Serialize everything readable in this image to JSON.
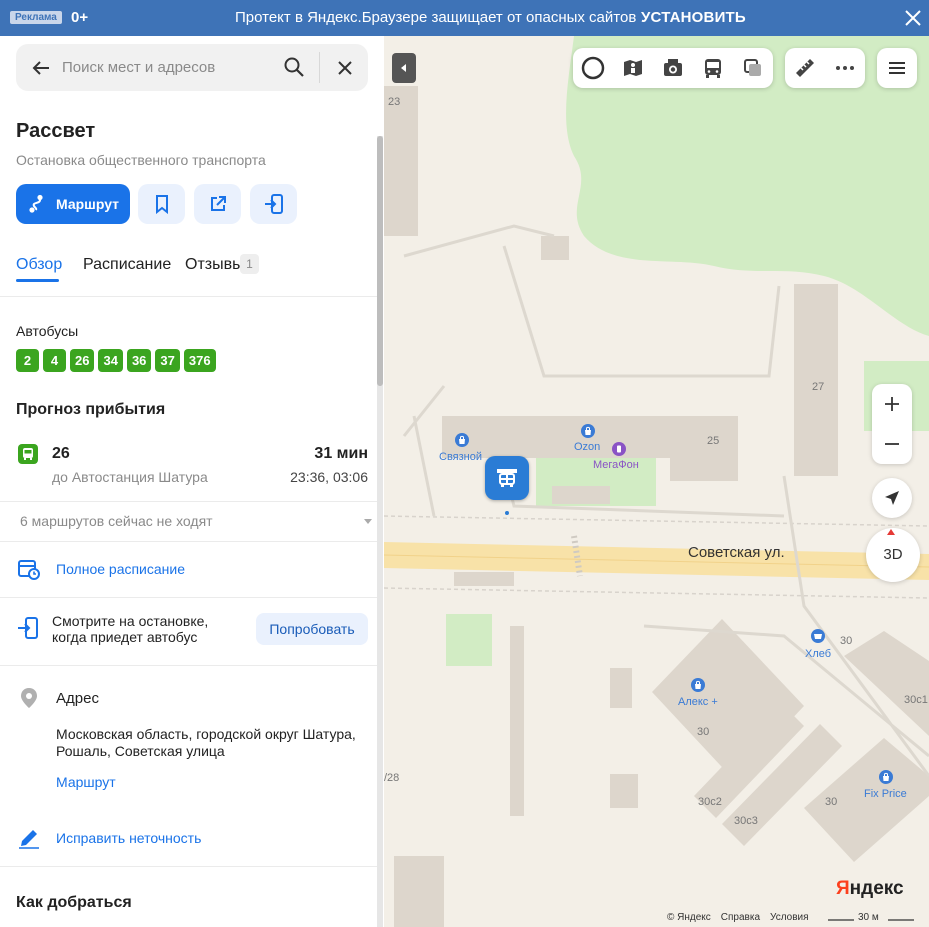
{
  "banner": {
    "ad_label": "Реклама",
    "age": "0+",
    "text": "Протект в Яндекс.Браузере защищает от опасных сайтов",
    "install": "УСТАНОВИТЬ"
  },
  "search": {
    "placeholder": "Поиск мест и адресов"
  },
  "place": {
    "title": "Рассвет",
    "subtitle": "Остановка общественного транспорта"
  },
  "actions": {
    "route_label": "Маршрут"
  },
  "tabs": [
    {
      "label": "Обзор",
      "active": true
    },
    {
      "label": "Расписание",
      "active": false
    },
    {
      "label": "Отзывы",
      "active": false,
      "count": "1"
    }
  ],
  "buses": {
    "label": "Автобусы",
    "routes": [
      "2",
      "4",
      "26",
      "34",
      "36",
      "37",
      "376"
    ]
  },
  "forecast": {
    "heading": "Прогноз прибытия",
    "route": "26",
    "destination": "до Автостанция Шатура",
    "eta": "31 мин",
    "times": "23:36, 03:06",
    "inactive": "6 маршрутов сейчас не ходят"
  },
  "full_schedule": "Полное расписание",
  "watch": {
    "text": "Смотрите на остановке, когда приедет автобус",
    "button": "Попробовать"
  },
  "address": {
    "heading": "Адрес",
    "text": "Московская область, городской округ Шатура, Рошаль, Советская улица",
    "route_link": "Маршрут"
  },
  "fix": "Исправить неточность",
  "how_to_get": "Как добраться",
  "map": {
    "street": "Советская ул.",
    "buildings": [
      "23",
      "27",
      "25",
      "30",
      "30c1",
      "30",
      "30c2",
      "30c3",
      "30",
      "/28"
    ],
    "pois": [
      "Связной",
      "Ozon",
      "МегаФон",
      "Хлеб",
      "Алекс +",
      "Fix Price"
    ],
    "btn_3d": "3D",
    "logo_y": "Я",
    "logo_rest": "ндекс",
    "footer": [
      "© Яндекс",
      "Справка",
      "Условия"
    ],
    "scale": "30 м"
  },
  "colors": {
    "accent": "#1a73e8",
    "bus_green": "#3ba51f",
    "banner": "#3e73b7",
    "stop_pin": "#2a7cd5"
  }
}
